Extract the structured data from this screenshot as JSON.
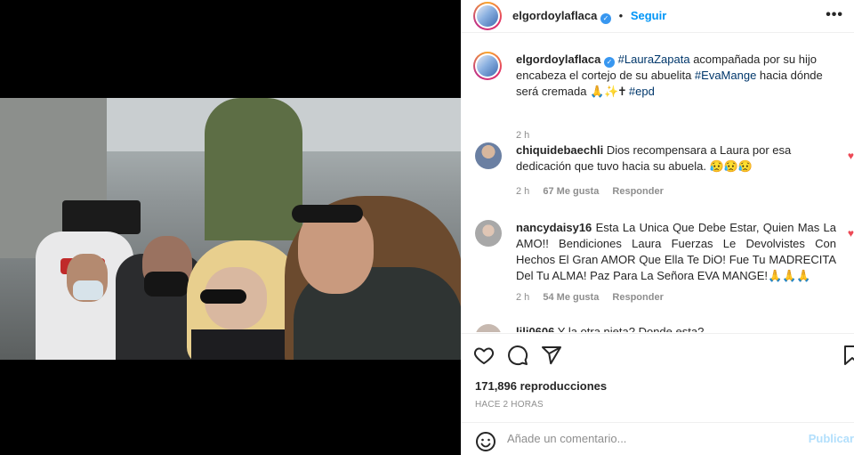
{
  "post": {
    "author": "elgordoylaflaca",
    "follow_label": "Seguir",
    "separator": "•",
    "more_label": "•••",
    "caption_author": "elgordoylaflaca",
    "caption_tag1": "#LauraZapata",
    "caption_text1": " acompañada por su hijo encabeza el cortejo de su abuelita ",
    "caption_tag2": "#EvaMange",
    "caption_text2": " hacia dónde será cremada 🙏✨🕇 ",
    "caption_tag3": "#epd",
    "caption_time": "2 h"
  },
  "comments": [
    {
      "username": "chiquidebaechli",
      "text": "Dios recompensara a Laura por esa dedicación que tuvo hacia su abuela. 😥😥😥",
      "time": "2 h",
      "likes": "67 Me gusta",
      "reply": "Responder"
    },
    {
      "username": "nancydaisy16",
      "text": "Esta La Unica Que Debe Estar, Quien Mas La AMO!! Bendiciones Laura Fuerzas Le Devolvistes Con Hechos El Gran AMOR Que Ella Te DiO! Fue Tu MADRECITA Del Tu ALMA! Paz Para La Señora EVA MANGE!🙏🙏🙏",
      "time": "2 h",
      "likes": "54 Me gusta",
      "reply": "Responder"
    },
    {
      "username": "lili0606",
      "text": "Y la otra nieta? Donde esta?"
    }
  ],
  "stats": {
    "views": "171,896 reproducciones",
    "posted": "HACE 2 HORAS"
  },
  "comment_input": {
    "placeholder": "Añade un comentario...",
    "post_label": "Publicar"
  },
  "icons": {
    "like": "heart-icon",
    "comment": "comment-icon",
    "share": "share-icon",
    "save": "bookmark-icon",
    "emoji": "emoji-icon",
    "verified": "verified-badge-icon"
  },
  "colors": {
    "accent": "#0095f6",
    "hashtag": "#00376b",
    "muted": "#8e8e8e"
  }
}
